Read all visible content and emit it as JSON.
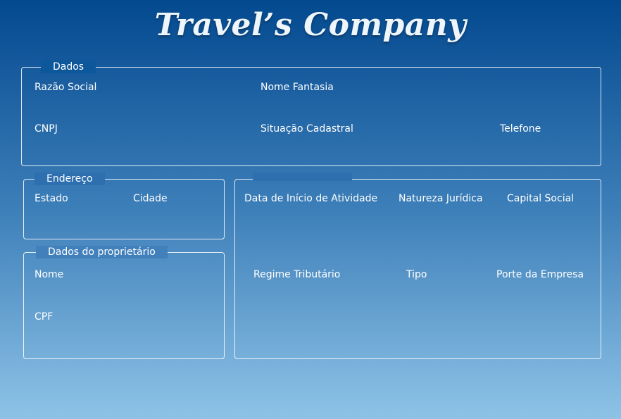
{
  "app": {
    "title": "Travel’s Company"
  },
  "dados": {
    "legend": "Dados",
    "razao_social": "Razão Social",
    "nome_fantasia": "Nome Fantasia",
    "cnpj": "CNPJ",
    "situacao_cadastral": "Situação Cadastral",
    "telefone": "Telefone"
  },
  "endereco": {
    "legend": "Endereço",
    "estado": "Estado",
    "cidade": "Cidade"
  },
  "proprietario": {
    "legend": "Dados do proprietário",
    "nome": "Nome",
    "cpf": "CPF"
  },
  "empresa": {
    "legend": "",
    "data_inicio": "Data de Início de Atividade",
    "natureza_juridica": "Natureza Jurídica",
    "capital_social": "Capital Social",
    "regime_tributario": "Regime Tributário",
    "tipo": "Tipo",
    "porte_empresa": "Porte da Empresa"
  }
}
